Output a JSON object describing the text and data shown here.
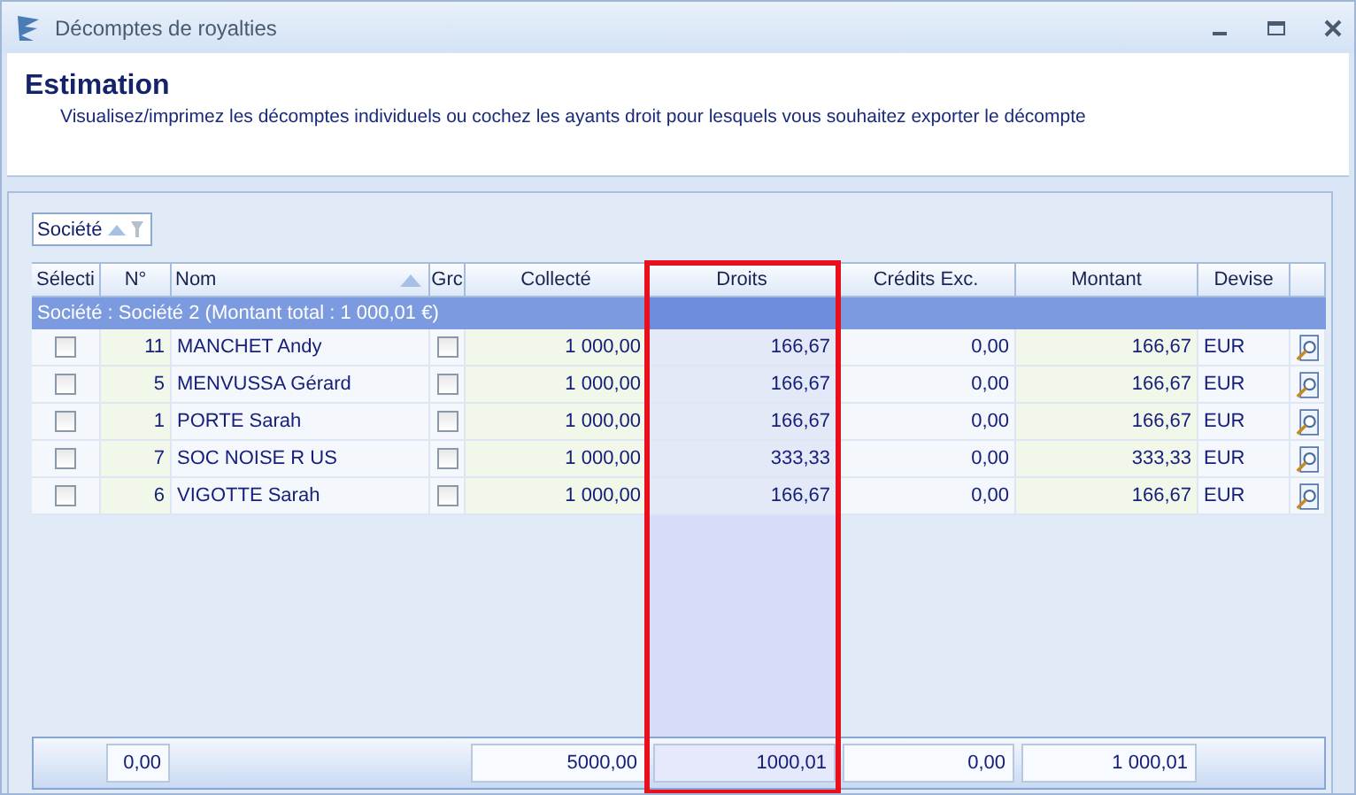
{
  "window": {
    "title": "Décomptes de royalties"
  },
  "header": {
    "title": "Estimation",
    "subtitle": "Visualisez/imprimez les décomptes individuels ou cochez les ayants droit pour lesquels vous souhaitez exporter le décompte"
  },
  "group_panel": {
    "chip": "Société"
  },
  "table": {
    "columns": [
      {
        "label": "Sélecti",
        "highlighted": false,
        "sorted": false
      },
      {
        "label": "N°",
        "highlighted": false,
        "sorted": false
      },
      {
        "label": "Nom",
        "highlighted": false,
        "sorted": true
      },
      {
        "label": "Grc",
        "highlighted": false,
        "sorted": false
      },
      {
        "label": "Collecté",
        "highlighted": false,
        "sorted": false
      },
      {
        "label": "Droits",
        "highlighted": true,
        "sorted": false
      },
      {
        "label": "Crédits Exc.",
        "highlighted": false,
        "sorted": false
      },
      {
        "label": "Montant",
        "highlighted": false,
        "sorted": false
      },
      {
        "label": "Devise",
        "highlighted": false,
        "sorted": false
      }
    ],
    "group_row": "Société : Société 2 (Montant total : 1 000,01 €)",
    "rows": [
      {
        "checked": false,
        "number": "11",
        "name": "MANCHET Andy",
        "grc_checked": false,
        "collecte": "1 000,00",
        "droits": "166,67",
        "credits": "0,00",
        "montant": "166,67",
        "devise": "EUR"
      },
      {
        "checked": false,
        "number": "5",
        "name": "MENVUSSA Gérard",
        "grc_checked": false,
        "collecte": "1 000,00",
        "droits": "166,67",
        "credits": "0,00",
        "montant": "166,67",
        "devise": "EUR"
      },
      {
        "checked": false,
        "number": "1",
        "name": "PORTE Sarah",
        "grc_checked": false,
        "collecte": "1 000,00",
        "droits": "166,67",
        "credits": "0,00",
        "montant": "166,67",
        "devise": "EUR"
      },
      {
        "checked": false,
        "number": "7",
        "name": "SOC NOISE R US",
        "grc_checked": false,
        "collecte": "1 000,00",
        "droits": "333,33",
        "credits": "0,00",
        "montant": "333,33",
        "devise": "EUR"
      },
      {
        "checked": false,
        "number": "6",
        "name": "VIGOTTE Sarah",
        "grc_checked": false,
        "collecte": "1 000,00",
        "droits": "166,67",
        "credits": "0,00",
        "montant": "166,67",
        "devise": "EUR"
      }
    ],
    "totals": {
      "number": "0,00",
      "collecte": "5000,00",
      "droits": "1000,01",
      "credits": "0,00",
      "montant": "1 000,01"
    }
  }
}
